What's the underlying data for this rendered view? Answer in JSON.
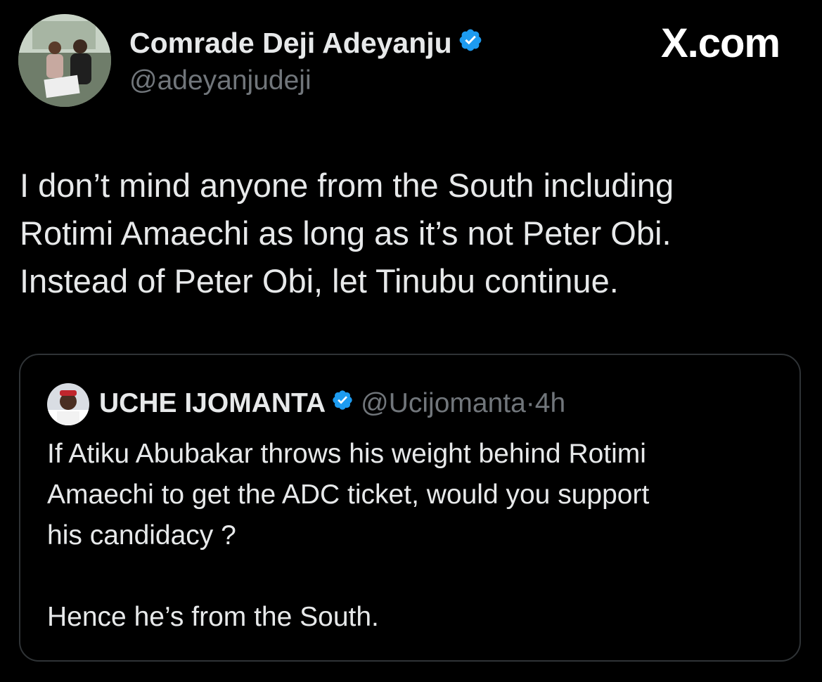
{
  "brand": "X.com",
  "tweet": {
    "author_name": "Comrade Deji Adeyanju",
    "author_handle": "@adeyanjudeji",
    "text_lines": [
      "I don’t mind anyone from the South including",
      "Rotimi Amaechi as long as it’s not Peter Obi.",
      "Instead of Peter Obi, let Tinubu continue."
    ]
  },
  "quoted_tweet": {
    "author_name": "UCHE IJOMANTA",
    "author_handle": "@Ucijomanta",
    "separator": "·",
    "time": "4h",
    "text_lines": [
      "If Atiku Abubakar throws his weight behind Rotimi",
      "Amaechi to get the ADC ticket, would you support",
      "his candidacy ?"
    ],
    "text_line_after_gap": "Hence he’s from the South."
  },
  "icons": {
    "verified": "verified-badge-icon",
    "verified_color": "#1d9bf0"
  },
  "colors": {
    "background": "#000000",
    "primary_text": "#e7e9ea",
    "secondary_text": "#71767b",
    "border": "#2f3336"
  }
}
